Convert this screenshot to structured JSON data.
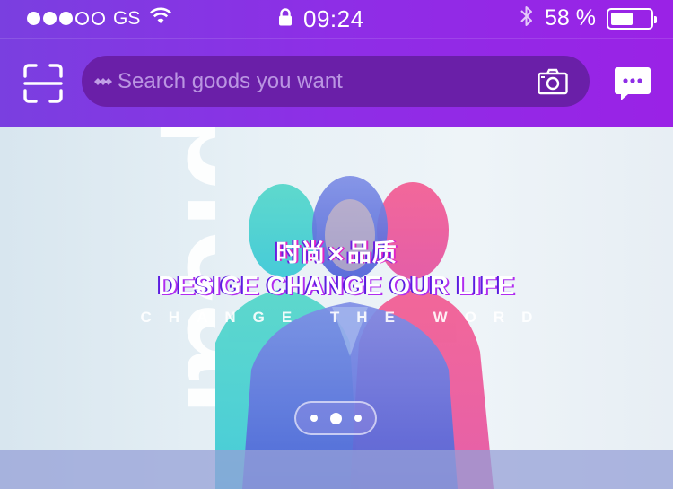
{
  "status_bar": {
    "signal_dots_filled": 3,
    "signal_dots_total": 5,
    "carrier": "GS",
    "time": "09:24",
    "battery_percent_text": "58 %",
    "battery_level": 0.58
  },
  "toolbar": {
    "search_placeholder": "Search goods you want"
  },
  "icons": {
    "wifi": "wifi-icon",
    "lock": "lock-icon",
    "bluetooth": "bluetooth-icon",
    "scan": "scan-icon",
    "camera": "camera-icon",
    "message": "message-icon"
  },
  "banner": {
    "title_cn": "时尚×品质",
    "title_en": "DESIGE CHANGE OUR LIFE",
    "subtitle": "CHANGE THE WORD",
    "background_word": "pican",
    "pager": {
      "count": 3,
      "active_index": 1
    }
  },
  "colors": {
    "header_start": "#7a3fe0",
    "header_end": "#9a22e6",
    "search_bg": "#6a1fa8"
  }
}
